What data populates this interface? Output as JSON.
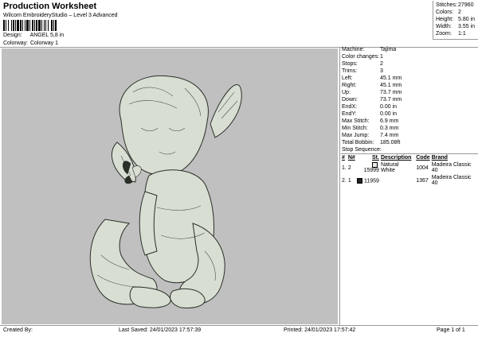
{
  "header": {
    "title": "Production Worksheet",
    "subtitle": "Wilcom EmbroideryStudio – Level 3 Advanced",
    "design_label": "Design:",
    "design_value": "ANGEL 5,8 in",
    "colorway_label": "Colorway:",
    "colorway_value": "Colorway 1"
  },
  "stats": [
    {
      "label": "Stitches:",
      "value": "27960"
    },
    {
      "label": "Colors:",
      "value": "2"
    },
    {
      "label": "Height:",
      "value": "5.80 in"
    },
    {
      "label": "Width:",
      "value": "3.55 in"
    },
    {
      "label": "Zoom:",
      "value": "1:1"
    }
  ],
  "params": [
    {
      "label": "Machine:",
      "value": "Tajima"
    },
    {
      "label": "Color changes:",
      "value": "1"
    },
    {
      "label": "Stops:",
      "value": "2"
    },
    {
      "label": "Trims:",
      "value": "3"
    },
    {
      "label": "Left:",
      "value": "45.1 mm"
    },
    {
      "label": "Right:",
      "value": "45.1 mm"
    },
    {
      "label": "Up:",
      "value": "73.7 mm"
    },
    {
      "label": "Down:",
      "value": "73.7 mm"
    },
    {
      "label": "EndX:",
      "value": "0.00 in"
    },
    {
      "label": "EndY:",
      "value": "0.00 in"
    },
    {
      "label": "Max Stitch:",
      "value": "6.9 mm"
    },
    {
      "label": "Min Stitch:",
      "value": "0.3 mm"
    },
    {
      "label": "Max Jump:",
      "value": "7.4 mm"
    },
    {
      "label": "Total Bobbin:",
      "value": "185.08ft"
    }
  ],
  "stop_sequence": {
    "title": "Stop Sequence:",
    "columns": [
      "#",
      "N#",
      "St.",
      "Description",
      "Code",
      "Brand"
    ],
    "rows": [
      {
        "num": "1.",
        "n": "2",
        "swatch": "#e8ebe4",
        "st": "15999",
        "desc": "Natural White",
        "code": "1004",
        "brand": "Madeira Classic 40"
      },
      {
        "num": "2.",
        "n": "1",
        "swatch": "#222222",
        "st": "11959",
        "desc": "",
        "code": "1367",
        "brand": "Madeira Classic 40"
      }
    ]
  },
  "colors": {
    "preview_bg": "#c0c0c0",
    "thread_fill": "#d8ded2",
    "thread_line": "#2a2f28"
  },
  "footer": {
    "created": "Created By:",
    "saved": "Last Saved: 24/01/2023 17:57:39",
    "printed": "Printed: 24/01/2023 17:57:42",
    "page": "Page 1 of 1"
  }
}
